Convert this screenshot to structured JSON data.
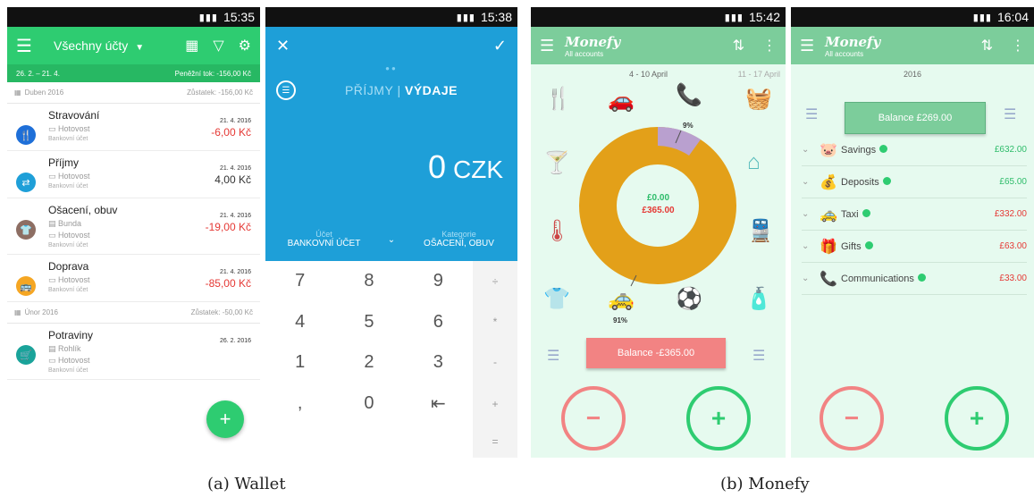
{
  "wallet": {
    "status_time": "15:35",
    "account_label": "Všechny účty",
    "period": "26. 2. – 21. 4.",
    "cashflow": "Peněžní tok: -156,00 Kč",
    "months": [
      {
        "name": "Duben 2016",
        "balance": "Zůstatek: -156,00 Kč"
      },
      {
        "name": "Únor 2016",
        "balance": "Zůstatek: -50,00 Kč"
      }
    ],
    "transactions": [
      {
        "title": "Stravování",
        "sub": "Hotovost",
        "sub2": "Bankovní účet",
        "date": "21. 4. 2016",
        "amount": "-6,00 Kč",
        "color": "#1e6fd8",
        "icon": "food-icon"
      },
      {
        "title": "Příjmy",
        "sub": "Hotovost",
        "sub2": "Bankovní účet",
        "date": "21. 4. 2016",
        "amount": "4,00 Kč",
        "color": "#1e9fd8",
        "icon": "income-icon"
      },
      {
        "title": "Ošacení, obuv",
        "note": "Bunda",
        "sub": "Hotovost",
        "sub2": "Bankovní účet",
        "date": "21. 4. 2016",
        "amount": "-19,00 Kč",
        "color": "#8d6e63",
        "icon": "shirt-icon"
      },
      {
        "title": "Doprava",
        "sub": "Hotovost",
        "sub2": "Bankovní účet",
        "date": "21. 4. 2016",
        "amount": "-85,00 Kč",
        "color": "#f5a623",
        "icon": "bus-icon"
      },
      {
        "title": "Potraviny",
        "note": "Rohlík",
        "sub": "Hotovost",
        "sub2": "Bankovní účet",
        "date": "26. 2. 2016",
        "amount": "",
        "color": "#1aa39a",
        "icon": "cart-icon"
      }
    ],
    "fab": "+"
  },
  "entry": {
    "status_time": "15:38",
    "tab_income": "PŘÍJMY",
    "tab_separator": "|",
    "tab_expense": "VÝDAJE",
    "amount": "0",
    "currency": "CZK",
    "account_label": "Účet",
    "account_value": "BANKOVNÍ ÚČET",
    "category_label": "Kategorie",
    "category_value": "OŠACENÍ, OBUV",
    "keys": [
      "7",
      "8",
      "9",
      "÷",
      "4",
      "5",
      "6",
      "*",
      "1",
      "2",
      "3",
      "-",
      ",",
      "0",
      "⇤",
      "+",
      "",
      "",
      "",
      "="
    ]
  },
  "monefy1": {
    "status_time": "15:42",
    "brand": "Monefy",
    "subtitle": "All accounts",
    "date_range": "4 - 10 April",
    "next_range": "11 - 17 April",
    "pct_small": "9%",
    "pct_large": "91%",
    "income": "£0.00",
    "expense": "£365.00",
    "balance": "Balance  -£365.00",
    "minus": "−",
    "plus": "+",
    "colors": {
      "main": "#e3a019",
      "slice": "#b9a0cf"
    }
  },
  "monefy2": {
    "status_time": "16:04",
    "brand": "Monefy",
    "subtitle": "All accounts",
    "year": "2016",
    "balance": "Balance  £269.00",
    "rows": [
      {
        "name": "Savings",
        "value": "£632.00",
        "kind": "green",
        "icon": "piggy-icon"
      },
      {
        "name": "Deposits",
        "value": "£65.00",
        "kind": "green",
        "icon": "money-bag-icon"
      },
      {
        "name": "Taxi",
        "value": "£332.00",
        "kind": "red",
        "icon": "taxi-icon"
      },
      {
        "name": "Gifts",
        "value": "£63.00",
        "kind": "red",
        "icon": "gift-icon"
      },
      {
        "name": "Communications",
        "value": "£33.00",
        "kind": "red",
        "icon": "phone-icon"
      }
    ],
    "minus": "−",
    "plus": "+"
  },
  "captions": {
    "a": "(a) Wallet",
    "b": "(b) Monefy"
  }
}
